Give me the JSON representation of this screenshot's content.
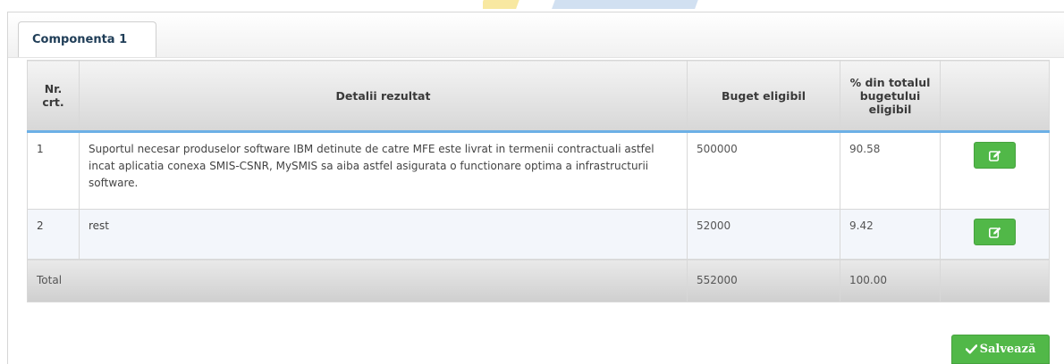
{
  "tab": {
    "label": "Componenta 1"
  },
  "table": {
    "headers": {
      "nr": "Nr. crt.",
      "details": "Detalii rezultat",
      "budget": "Buget eligibil",
      "percent": "% din totalul bugetului eligibil"
    },
    "rows": [
      {
        "nr": "1",
        "details": "Suportul necesar produselor software IBM detinute de catre MFE este livrat in termenii contractuali astfel incat aplicatia conexa SMIS-CSNR, MySMIS sa aiba astfel asigurata o functionare optima a infrastructurii software.",
        "budget": "500000",
        "percent": "90.58"
      },
      {
        "nr": "2",
        "details": "rest",
        "budget": "52000",
        "percent": "9.42"
      }
    ],
    "total": {
      "label": "Total",
      "budget": "552000",
      "percent": "100.00"
    }
  },
  "icons": {
    "edit": "pencil-square-icon",
    "save": "check-icon"
  },
  "colors": {
    "accent": "#51b848",
    "header_underline": "#6cb0e6"
  },
  "save_button": {
    "label": "Salvează"
  }
}
